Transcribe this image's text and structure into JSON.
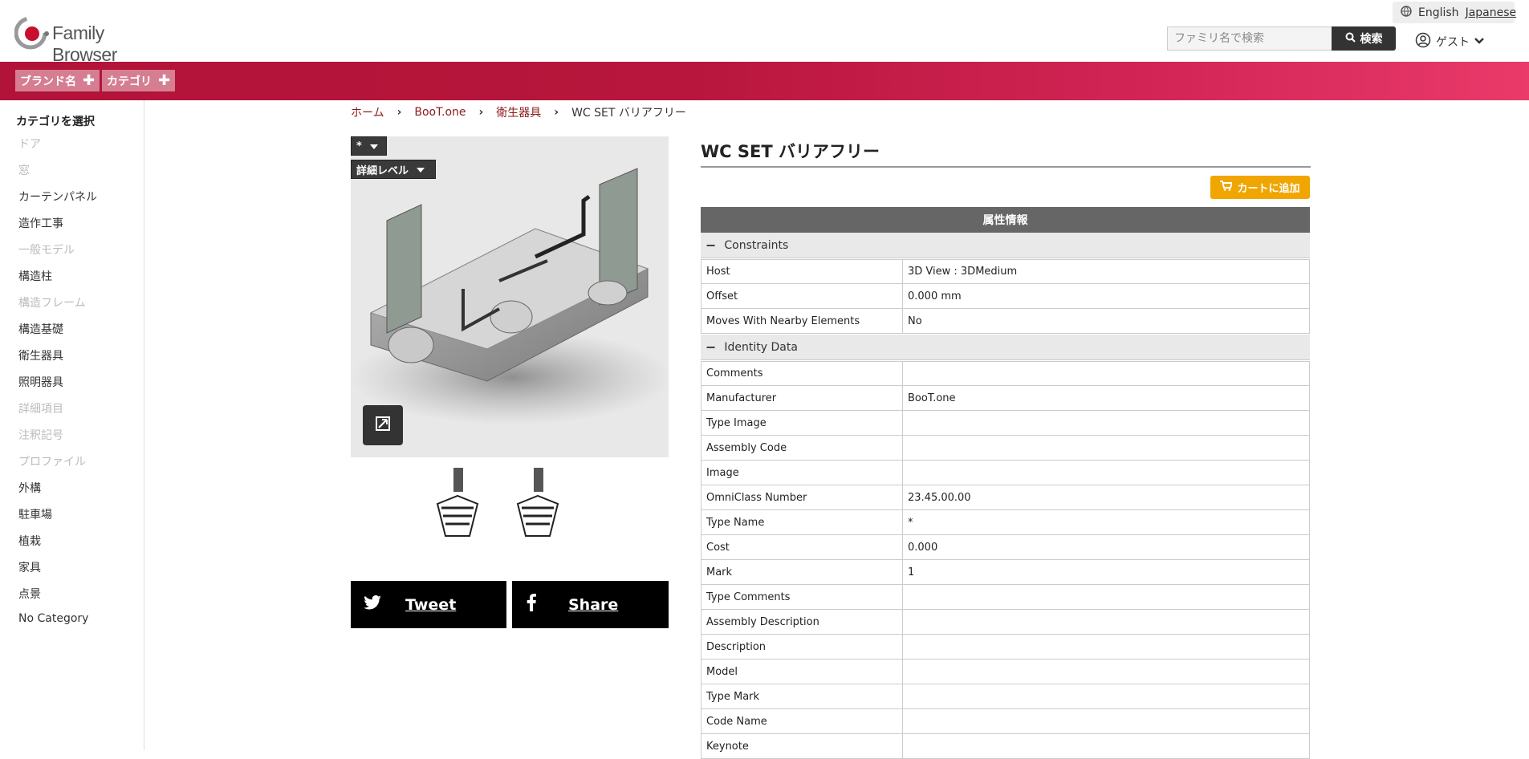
{
  "header": {
    "logo_text": "Family Browser",
    "lang_english": "English",
    "lang_japanese": "Japanese",
    "search_placeholder": "ファミリ名で検索",
    "search_button": "検索",
    "user_label": "ゲスト"
  },
  "nav": {
    "brand_label": "ブランド名",
    "category_label": "カテゴリ"
  },
  "sidebar": {
    "title": "カテゴリを選択",
    "items": [
      {
        "label": "ドア",
        "enabled": false
      },
      {
        "label": "窓",
        "enabled": false
      },
      {
        "label": "カーテンパネル",
        "enabled": true
      },
      {
        "label": "造作工事",
        "enabled": true
      },
      {
        "label": "一般モデル",
        "enabled": false
      },
      {
        "label": "構造柱",
        "enabled": true
      },
      {
        "label": "構造フレーム",
        "enabled": false
      },
      {
        "label": "構造基礎",
        "enabled": true
      },
      {
        "label": "衛生器具",
        "enabled": true
      },
      {
        "label": "照明器具",
        "enabled": true
      },
      {
        "label": "詳細項目",
        "enabled": false
      },
      {
        "label": "注釈記号",
        "enabled": false
      },
      {
        "label": "プロファイル",
        "enabled": false
      },
      {
        "label": "外構",
        "enabled": true
      },
      {
        "label": "駐車場",
        "enabled": true
      },
      {
        "label": "植栽",
        "enabled": true
      },
      {
        "label": "家具",
        "enabled": true
      },
      {
        "label": "点景",
        "enabled": true
      },
      {
        "label": "No Category",
        "enabled": true
      }
    ]
  },
  "breadcrumb": {
    "home": "ホーム",
    "brand": "BooT.one",
    "category": "衛生器具",
    "current": "WC SET バリアフリー"
  },
  "viewer": {
    "type_select": "*",
    "detail_select": "詳細レベル"
  },
  "share": {
    "tweet": "Tweet",
    "share": "Share"
  },
  "product": {
    "title": "WC SET バリアフリー",
    "cart_button": "カートに追加",
    "attr_header": "属性情報"
  },
  "groups": {
    "constraints": "Constraints",
    "identity": "Identity Data"
  },
  "constraints": [
    {
      "k": "Host",
      "v": "3D View : 3DMedium"
    },
    {
      "k": "Offset",
      "v": "0.000 mm"
    },
    {
      "k": "Moves With Nearby Elements",
      "v": "No"
    }
  ],
  "identity": [
    {
      "k": "Comments",
      "v": ""
    },
    {
      "k": "Manufacturer",
      "v": "BooT.one"
    },
    {
      "k": "Type Image",
      "v": ""
    },
    {
      "k": "Assembly Code",
      "v": ""
    },
    {
      "k": "Image",
      "v": ""
    },
    {
      "k": "OmniClass Number",
      "v": "23.45.00.00"
    },
    {
      "k": "Type Name",
      "v": "*"
    },
    {
      "k": "Cost",
      "v": "0.000"
    },
    {
      "k": "Mark",
      "v": "1"
    },
    {
      "k": "Type Comments",
      "v": ""
    },
    {
      "k": "Assembly Description",
      "v": ""
    },
    {
      "k": "Description",
      "v": ""
    },
    {
      "k": "Model",
      "v": ""
    },
    {
      "k": "Type Mark",
      "v": ""
    },
    {
      "k": "Code Name",
      "v": ""
    },
    {
      "k": "Keynote",
      "v": ""
    }
  ]
}
